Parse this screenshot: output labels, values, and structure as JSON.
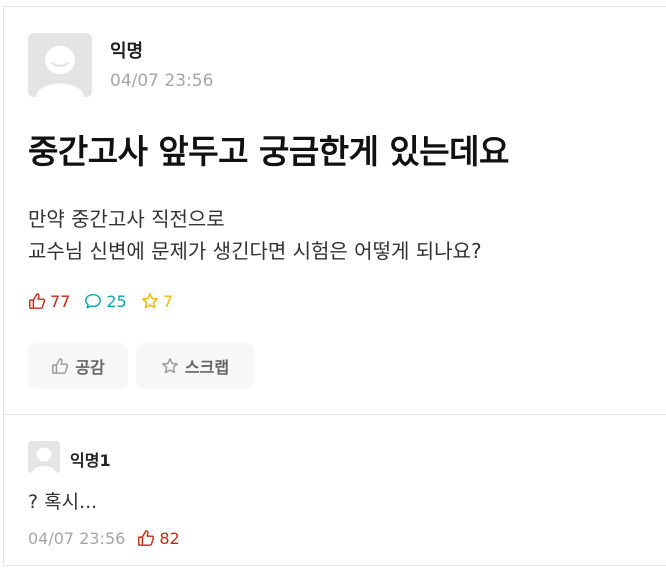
{
  "post": {
    "author": "익명",
    "datetime": "04/07 23:56",
    "title": "중간고사 앞두고 궁금한게 있는데요",
    "body_lines": [
      "만약 중간고사 직전으로",
      "교수님 신변에 문제가 생긴다면 시험은 어떻게 되나요?"
    ],
    "stats": {
      "likes": "77",
      "comments": "25",
      "scraps": "7"
    },
    "buttons": {
      "like_label": "공감",
      "scrap_label": "스크랩"
    },
    "icons": {
      "like": "thumbs-up-icon",
      "comment": "speech-bubble-icon",
      "scrap": "star-icon"
    }
  },
  "comment": {
    "author": "익명1",
    "text": "? 혹시...",
    "datetime": "04/07 23:56",
    "likes": "82"
  },
  "colors": {
    "like": "#c62917",
    "comment": "#0ca5af",
    "scrap": "#f2b600",
    "meta": "#a6a6a6"
  }
}
